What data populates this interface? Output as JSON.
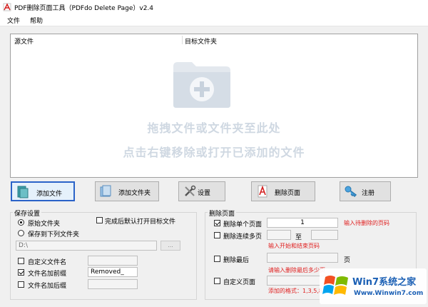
{
  "window": {
    "title": "PDF删除页面工具（PDFdo Delete Page）v2.4"
  },
  "menu": [
    {
      "label": "文件"
    },
    {
      "label": "帮助"
    }
  ],
  "file_list": {
    "columns": [
      {
        "label": "源文件"
      },
      {
        "label": "目标文件夹"
      }
    ],
    "hint_line1": "拖拽文件或文件夹至此处",
    "hint_line2": "点击右键移除或打开已添加的文件"
  },
  "toolbar": {
    "add_file": "添加文件",
    "add_folder": "添加文件夹",
    "settings": "设置",
    "delete_pages": "删除页面",
    "register": "注册"
  },
  "save_settings": {
    "title": "保存设置",
    "opt_original": "原始文件夹",
    "opt_save_to": "保存到下列文件夹",
    "open_after": "完成后默认打开目标文件",
    "path_value": "D:\\",
    "browse_label": "...",
    "custom_name": "自定义文件名",
    "add_prefix": "文件名加前缀",
    "prefix_value": "Removed_",
    "add_suffix": "文件名加后缀"
  },
  "delete_pages": {
    "title": "删除页面",
    "single": "删除单个页面",
    "single_value": "1",
    "single_hint": "输入待删除的页码",
    "range": "删除连续多页",
    "range_to": "至",
    "range_hint": "输入开始和结束页码",
    "last": "删除最后",
    "last_unit": "页",
    "last_hint": "请输入删除最后多少页",
    "custom": "自定义页面",
    "custom_hint": "添加的格式：1,3,5,8,10-20"
  },
  "watermark": {
    "brand": "Win7系统之家",
    "url": "Www.Winwin7.com"
  },
  "colors": {
    "accent": "#2a63c8",
    "hint": "#e02020",
    "watermark_blue": "#1a5fb4"
  }
}
